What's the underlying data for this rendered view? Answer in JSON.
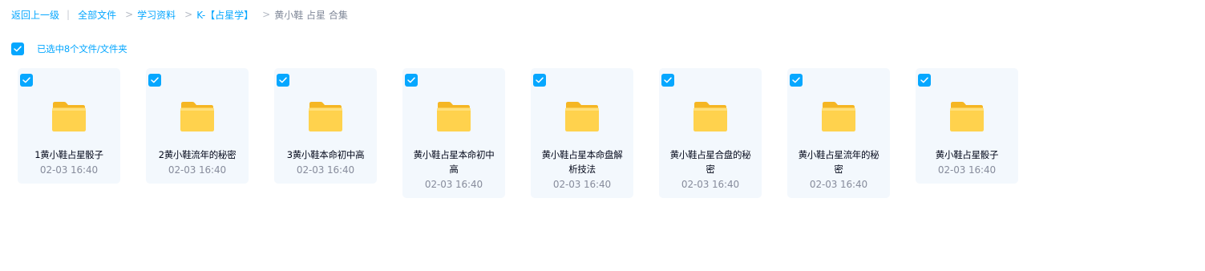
{
  "breadcrumb": {
    "back": "返回上一级",
    "pipe": "|",
    "sep": ">",
    "items": [
      {
        "label": "全部文件"
      },
      {
        "label": "学习资料"
      },
      {
        "label": "K-【占星学】"
      },
      {
        "label": "黄小鞋 占星 合集"
      }
    ]
  },
  "selection": {
    "checked": true,
    "text": "已选中8个文件/文件夹"
  },
  "files": [
    {
      "name": "1黄小鞋占星骰子",
      "time": "02-03 16:40",
      "checked": true
    },
    {
      "name": "2黄小鞋流年的秘密",
      "time": "02-03 16:40",
      "checked": true
    },
    {
      "name": "3黄小鞋本命初中高",
      "time": "02-03 16:40",
      "checked": true
    },
    {
      "name": "黄小鞋占星本命初中高",
      "time": "02-03 16:40",
      "checked": true
    },
    {
      "name": "黄小鞋占星本命盘解析技法",
      "time": "02-03 16:40",
      "checked": true
    },
    {
      "name": "黄小鞋占星合盘的秘密",
      "time": "02-03 16:40",
      "checked": true
    },
    {
      "name": "黄小鞋占星流年的秘密",
      "time": "02-03 16:40",
      "checked": true
    },
    {
      "name": "黄小鞋占星骰子",
      "time": "02-03 16:40",
      "checked": true
    }
  ],
  "icons": {
    "checkbox": "check-icon",
    "file": "folder-icon"
  },
  "colors": {
    "accent": "#06a7ff",
    "card_bg": "#f3f8fd",
    "folder_top": "#ffd95a",
    "folder_back": "#f5b623"
  }
}
